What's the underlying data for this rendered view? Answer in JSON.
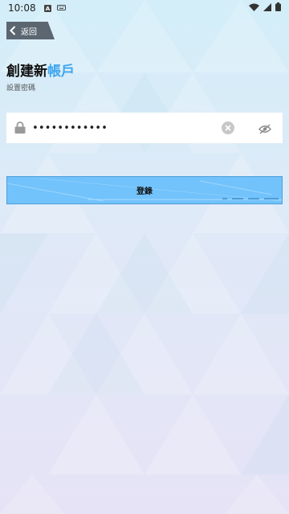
{
  "status_bar": {
    "time": "10:08",
    "icons": [
      "notification-a-icon",
      "keyboard-icon",
      "wifi-icon",
      "signal-icon",
      "battery-icon"
    ]
  },
  "nav": {
    "back_label": "返回"
  },
  "header": {
    "title_main": "創建新",
    "title_accent": "帳戶",
    "subtitle": "設置密碼"
  },
  "form": {
    "password_value": "••••••••••••",
    "password_placeholder": ""
  },
  "actions": {
    "login_label": "登錄"
  },
  "colors": {
    "accent": "#3ea6ee",
    "button": "#72c2fb",
    "back_button": "#5b6670"
  }
}
